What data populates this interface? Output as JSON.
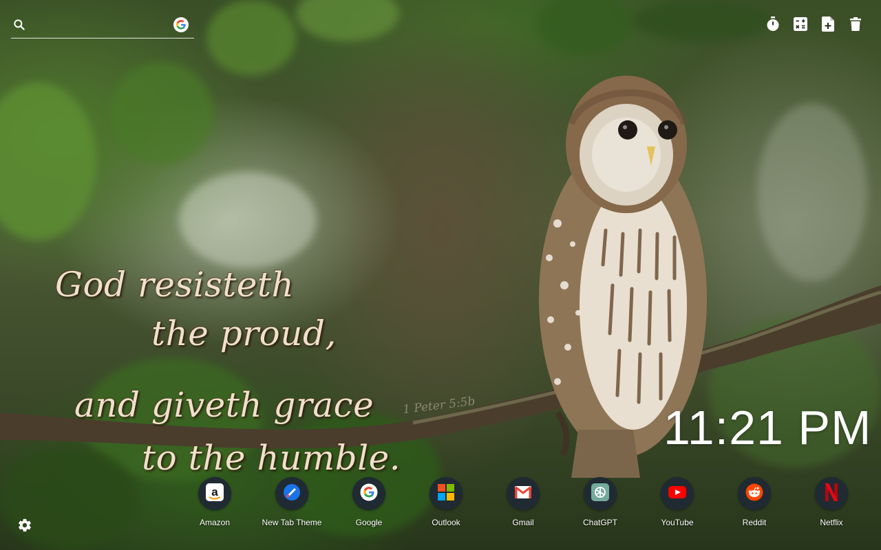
{
  "search": {
    "placeholder": ""
  },
  "tools": [
    {
      "name": "timer-icon"
    },
    {
      "name": "calculator-icon"
    },
    {
      "name": "new-note-icon"
    },
    {
      "name": "trash-icon"
    }
  ],
  "quote": {
    "line1": "God resisteth",
    "line2": "the proud,",
    "line3": "and giveth grace",
    "line4": "to the humble.",
    "reference": "1 Peter 5:5b"
  },
  "clock": {
    "time": "11:21 PM"
  },
  "shortcuts": [
    {
      "label": "Amazon",
      "icon": "amazon-icon",
      "color": "#ff9900"
    },
    {
      "label": "New Tab Theme",
      "icon": "new-tab-theme-icon",
      "color": "#1a73e8"
    },
    {
      "label": "Google",
      "icon": "google-icon",
      "color": "#4285f4"
    },
    {
      "label": "Outlook",
      "icon": "outlook-icon",
      "color": "#0078d4"
    },
    {
      "label": "Gmail",
      "icon": "gmail-icon",
      "color": "#ea4335"
    },
    {
      "label": "ChatGPT",
      "icon": "chatgpt-icon",
      "color": "#74aa9c"
    },
    {
      "label": "YouTube",
      "icon": "youtube-icon",
      "color": "#ff0000"
    },
    {
      "label": "Reddit",
      "icon": "reddit-icon",
      "color": "#ff4500"
    },
    {
      "label": "Netflix",
      "icon": "netflix-icon",
      "color": "#e50914"
    }
  ],
  "settings": {
    "icon": "gear-icon"
  }
}
